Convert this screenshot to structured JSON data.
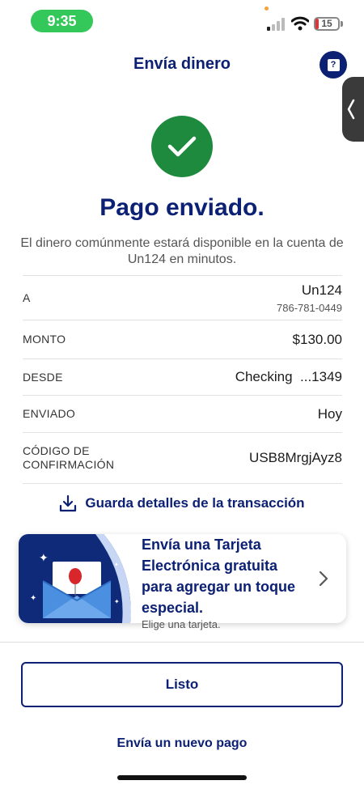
{
  "status_bar": {
    "time": "9:35",
    "battery": "15"
  },
  "header": {
    "title": "Envía dinero",
    "help_glyph": "?"
  },
  "success": {
    "title": "Pago enviado.",
    "message": "El dinero comúnmente estará disponible en la cuenta de Un124 en minutos."
  },
  "details": {
    "to": {
      "label": "A",
      "name": "Un124",
      "phone": "786-781-0449"
    },
    "amount": {
      "label": "MONTO",
      "value": "$130.00"
    },
    "from": {
      "label": "DESDE",
      "value": "Checking  ...1349"
    },
    "sent": {
      "label": "ENVIADO",
      "value": "Hoy"
    },
    "confirmation": {
      "label_line1": "CÓDIGO DE",
      "label_line2": "CONFIRMACIÓN",
      "value": "USB8MrgjAyz8"
    }
  },
  "save_details": {
    "label": "Guarda detalles de la transacción",
    "icon": "download-icon"
  },
  "promo": {
    "line1": "Envía una Tarjeta",
    "line2": "Electrónica gratuita",
    "line3": "para agregar un toque",
    "line4": "especial.",
    "subtitle": "Elige una tarjeta."
  },
  "actions": {
    "done": "Listo",
    "new_payment": "Envía un nuevo pago"
  },
  "colors": {
    "brand": "#0c2074",
    "success": "#1e8a3e",
    "time_pill": "#34c759",
    "battery_low": "#d7383b"
  }
}
